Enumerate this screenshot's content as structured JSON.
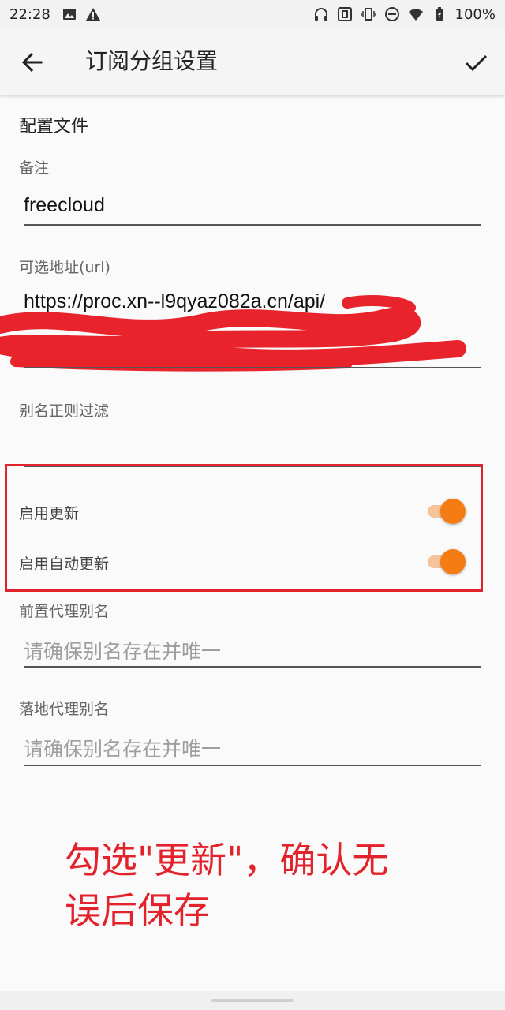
{
  "status_bar": {
    "time": "22:28",
    "battery": "100%",
    "icons": [
      "image-icon",
      "warning-icon",
      "headphones-icon",
      "nfc-icon",
      "vibrate-icon",
      "dnd-icon",
      "wifi-icon",
      "battery-icon"
    ]
  },
  "app_bar": {
    "title": "订阅分组设置",
    "back_icon": "back-arrow-icon",
    "confirm_icon": "check-icon"
  },
  "form": {
    "section_title": "配置文件",
    "remark": {
      "label": "备注",
      "value": "freecloud"
    },
    "url": {
      "label": "可选地址(url)",
      "value": "https://proc.xn--l9qyaz082a.cn/api/"
    },
    "alias_filter": {
      "label": "别名正则过滤",
      "value": ""
    },
    "enable_update": {
      "label": "启用更新",
      "checked": true
    },
    "enable_auto_update": {
      "label": "启用自动更新",
      "checked": true
    },
    "front_proxy": {
      "label": "前置代理别名",
      "placeholder": "请确保别名存在并唯一"
    },
    "landing_proxy": {
      "label": "落地代理别名",
      "placeholder": "请确保别名存在并唯一"
    }
  },
  "annotation": {
    "line1": "勾选\"更新\"，确认无",
    "line2": "误后保存"
  },
  "colors": {
    "accent": "#f57c13",
    "accent_track": "#f7c49a",
    "annotation_red": "#e3232b"
  }
}
